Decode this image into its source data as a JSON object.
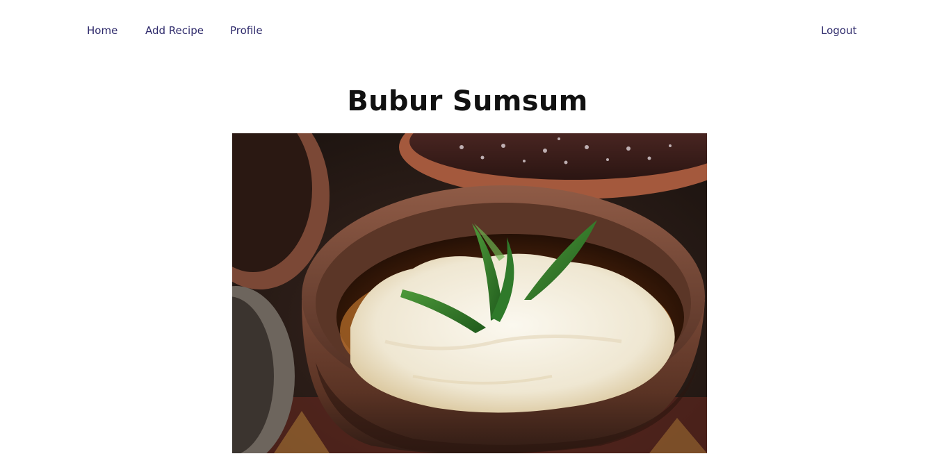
{
  "nav": {
    "home": "Home",
    "add_recipe": "Add Recipe",
    "profile": "Profile",
    "logout": "Logout",
    "link_color": "#2e2a6b"
  },
  "recipe": {
    "title": "Bubur Sumsum",
    "image_alt_icon": "recipe-photo"
  }
}
